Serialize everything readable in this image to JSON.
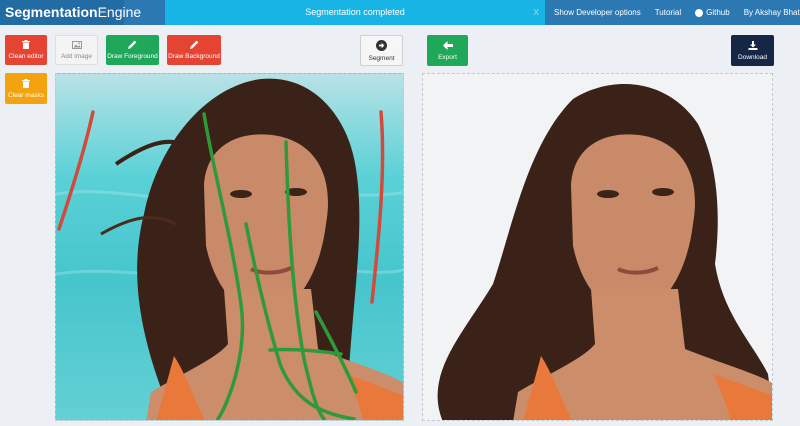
{
  "navbar": {
    "brand_bold": "Segmentation",
    "brand_light": "Engine",
    "notice": "Segmentation completed",
    "notice_close": "x",
    "links": [
      "Show Developer options",
      "Tutorial",
      "Github",
      "By Akshay Bhat"
    ]
  },
  "toolbar": {
    "clean_editor": "Clean editor",
    "add_image": "Add image",
    "draw_foreground": "Draw Foreground",
    "draw_background": "Draw Background",
    "clear_masks": "Clear masks",
    "segment": "Segment",
    "export": "Export",
    "download": "Download"
  },
  "colors": {
    "navbar": "#2b78b3",
    "notice": "#18b4e6",
    "danger": "#e64433",
    "success": "#1fa85a",
    "warning": "#f2a30f",
    "download": "#152744",
    "foreground_stroke": "#2f9a3a",
    "background_stroke": "#d24a3c"
  },
  "icons": {
    "clean_editor": "trash-icon",
    "add_image": "image-icon",
    "draw_foreground": "pencil-icon",
    "draw_background": "pencil-icon",
    "clear_masks": "trash-icon",
    "segment": "arrow-right-circle-icon",
    "export": "arrow-left-icon",
    "download": "download-icon",
    "github": "github-icon"
  }
}
